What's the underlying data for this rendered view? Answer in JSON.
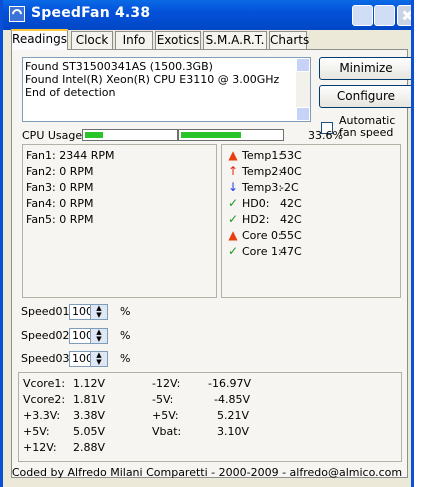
{
  "app_title": "SpeedFan 4.38",
  "tabs": [
    "Readings",
    "Clock",
    "Info",
    "Exotics",
    "S.M.A.R.T.",
    "Charts"
  ],
  "log_lines": [
    "Found ST31500341AS (1500.3GB)",
    "Found Intel(R) Xeon(R) CPU E3110 @ 3.00GHz",
    "End of detection"
  ],
  "buttons": {
    "minimize": "Minimize",
    "configure": "Configure"
  },
  "auto_fan_speed": {
    "label": "Automatic fan speed",
    "checked": false
  },
  "cpu_usage": {
    "label": "CPU Usage",
    "percent_text": "33.6%",
    "core_loads": [
      0.2,
      0.6
    ]
  },
  "fans": [
    {
      "label": "Fan1:",
      "value": "2344 RPM"
    },
    {
      "label": "Fan2:",
      "value": "0 RPM"
    },
    {
      "label": "Fan3:",
      "value": "0 RPM"
    },
    {
      "label": "Fan4:",
      "value": "0 RPM"
    },
    {
      "label": "Fan5:",
      "value": "0 RPM"
    }
  ],
  "temps": [
    {
      "label": "Temp1:",
      "value": "53C",
      "icon": "flame-icon"
    },
    {
      "label": "Temp2:",
      "value": "40C",
      "icon": "arrow-up-icon"
    },
    {
      "label": "Temp3:",
      "value": "-2C",
      "icon": "arrow-down-icon"
    },
    {
      "label": "HD0:",
      "value": "42C",
      "icon": "checkmark-icon"
    },
    {
      "label": "HD2:",
      "value": "42C",
      "icon": "checkmark-icon"
    },
    {
      "label": "Core 0:",
      "value": "55C",
      "icon": "flame-icon"
    },
    {
      "label": "Core 1:",
      "value": "47C",
      "icon": "checkmark-icon"
    }
  ],
  "speeds": [
    {
      "label": "Speed01:",
      "value": "100",
      "unit": "%"
    },
    {
      "label": "Speed02:",
      "value": "100",
      "unit": "%"
    },
    {
      "label": "Speed03:",
      "value": "100",
      "unit": "%"
    }
  ],
  "voltages_left": [
    {
      "label": "Vcore1:",
      "value": "1.12V"
    },
    {
      "label": "Vcore2:",
      "value": "1.81V"
    },
    {
      "label": "+3.3V:",
      "value": "3.38V"
    },
    {
      "label": "+5V:",
      "value": "5.05V"
    },
    {
      "label": "+12V:",
      "value": "2.88V"
    }
  ],
  "voltages_right": [
    {
      "label": "-12V:",
      "value": "-16.97V"
    },
    {
      "label": "-5V:",
      "value": "-4.85V"
    },
    {
      "label": "+5V:",
      "value": "5.21V"
    },
    {
      "label": "Vbat:",
      "value": "3.10V"
    }
  ],
  "footer": "Coded by Alfredo Milani Comparetti - 2000-2009 - alfredo@almico.com",
  "colors": {
    "title_bar": "#0451d9",
    "bar_fill": "#28c42a",
    "flame": "#e8400c",
    "arrow_up": "#e8200c",
    "arrow_down": "#1c3ce8",
    "check": "#1a9a1a"
  }
}
